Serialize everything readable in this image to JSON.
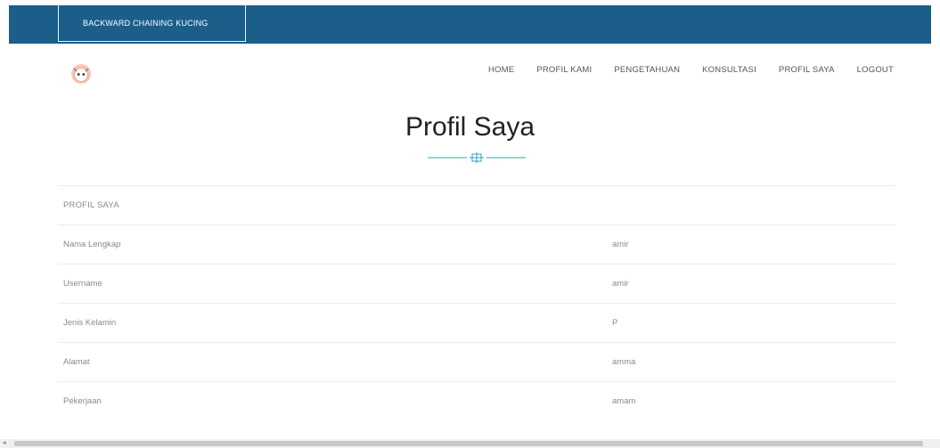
{
  "header": {
    "brand": "BACKWARD CHAINING KUCING"
  },
  "nav": {
    "items": [
      "HOME",
      "PROFIL KAMI",
      "PENGETAHUAN",
      "KONSULTASI",
      "PROFIL SAYA",
      "LOGOUT"
    ]
  },
  "page": {
    "title": "Profil Saya"
  },
  "profile": {
    "heading": "PROFIL SAYA",
    "rows": [
      {
        "label": "Nama Lengkap",
        "value": "amir"
      },
      {
        "label": "Username",
        "value": "amir"
      },
      {
        "label": "Jenis Kelamin",
        "value": "P"
      },
      {
        "label": "Alamat",
        "value": "amma"
      },
      {
        "label": "Pekerjaan",
        "value": "amam"
      }
    ]
  },
  "colors": {
    "topbar": "#1b5e8a",
    "divider": "#2aa7b8"
  }
}
